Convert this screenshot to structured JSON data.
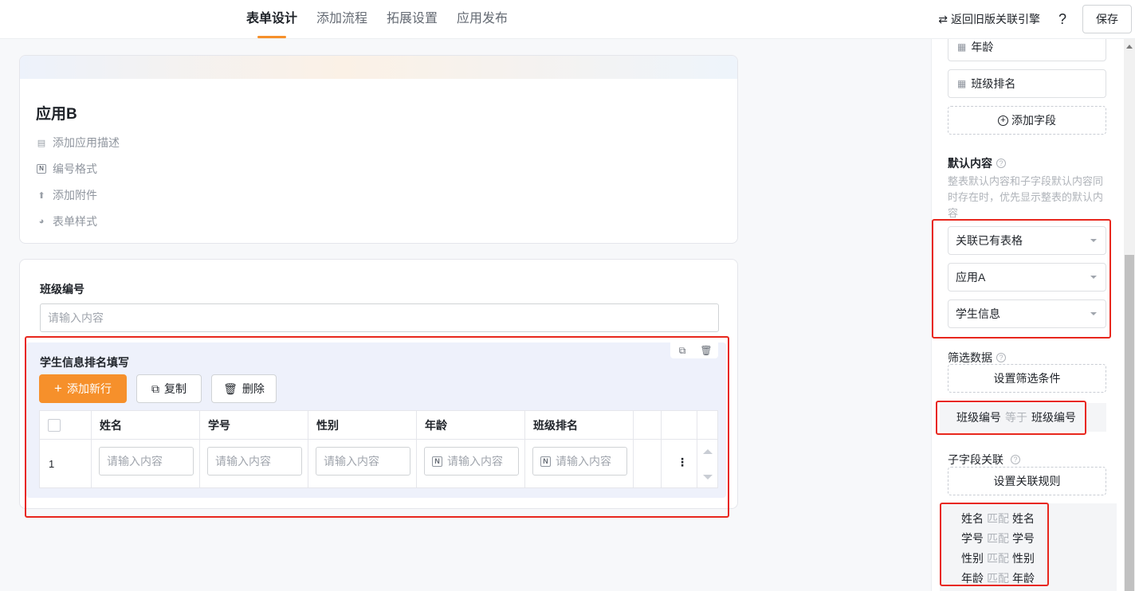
{
  "header": {
    "tabs": [
      "表单设计",
      "添加流程",
      "拓展设置",
      "应用发布"
    ],
    "active_tab": 0,
    "back_link": "返回旧版关联引擎",
    "back_icon": "swap-icon",
    "help": "?",
    "save_label": "保存"
  },
  "app_card": {
    "title": "应用B",
    "options": [
      {
        "label": "添加应用描述",
        "icon": "comment-icon"
      },
      {
        "label": "编号格式",
        "icon": "number-icon"
      },
      {
        "label": "添加附件",
        "icon": "upload-icon"
      },
      {
        "label": "表单样式",
        "icon": "palette-icon"
      }
    ]
  },
  "form": {
    "class_field": {
      "label": "班级编号",
      "placeholder": "请输入内容"
    },
    "subform": {
      "title": "学生信息排名填写",
      "add_row": "添加新行",
      "copy": "复制",
      "delete": "删除",
      "columns": [
        "姓名",
        "学号",
        "性别",
        "年龄",
        "班级排名"
      ],
      "row_number": "1",
      "cell_placeholder": "请输入内容",
      "more": "⋮"
    }
  },
  "right_panel": {
    "fields": [
      "年龄",
      "班级排名"
    ],
    "add_field": "添加字段",
    "default_content": {
      "title": "默认内容",
      "hint": "整表默认内容和子字段默认内容同时存在时，优先显示整表的默认内容",
      "selects": [
        "关联已有表格",
        "应用A",
        "学生信息"
      ]
    },
    "filter": {
      "title": "筛选数据",
      "button": "设置筛选条件",
      "condition": {
        "left": "班级编号",
        "op": "等于",
        "right": "班级编号"
      }
    },
    "subfield_link": {
      "title": "子字段关联",
      "button": "设置关联规则",
      "mappings": [
        {
          "left": "姓名",
          "op": "匹配",
          "right": "姓名"
        },
        {
          "left": "学号",
          "op": "匹配",
          "right": "学号"
        },
        {
          "left": "性别",
          "op": "匹配",
          "right": "性别"
        },
        {
          "left": "年龄",
          "op": "匹配",
          "right": "年龄"
        }
      ]
    }
  },
  "colors": {
    "accent": "#f6902b",
    "highlight": "#e8271d",
    "subform_bg": "#eef1fb"
  }
}
